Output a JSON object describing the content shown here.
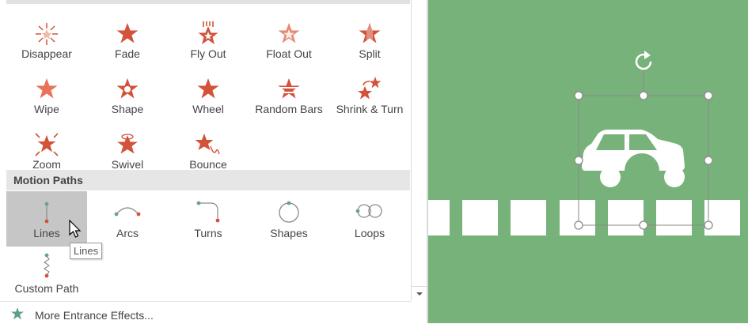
{
  "entrance_effects": [
    {
      "label": "Disappear",
      "icon": "disappear-star-icon"
    },
    {
      "label": "Fade",
      "icon": "fade-star-icon"
    },
    {
      "label": "Fly Out",
      "icon": "fly-out-star-icon"
    },
    {
      "label": "Float Out",
      "icon": "float-out-star-icon"
    },
    {
      "label": "Split",
      "icon": "split-star-icon"
    },
    {
      "label": "Wipe",
      "icon": "wipe-star-icon"
    },
    {
      "label": "Shape",
      "icon": "shape-star-icon"
    },
    {
      "label": "Wheel",
      "icon": "wheel-star-icon"
    },
    {
      "label": "Random Bars",
      "icon": "random-bars-star-icon"
    },
    {
      "label": "Shrink & Turn",
      "icon": "shrink-turn-star-icon"
    },
    {
      "label": "Zoom",
      "icon": "zoom-star-icon"
    },
    {
      "label": "Swivel",
      "icon": "swivel-star-icon"
    },
    {
      "label": "Bounce",
      "icon": "bounce-star-icon"
    }
  ],
  "motion_paths": {
    "header": "Motion Paths",
    "items": [
      {
        "label": "Lines",
        "icon": "lines-path-icon",
        "selected": true
      },
      {
        "label": "Arcs",
        "icon": "arcs-path-icon"
      },
      {
        "label": "Turns",
        "icon": "turns-path-icon"
      },
      {
        "label": "Shapes",
        "icon": "shapes-path-icon"
      },
      {
        "label": "Loops",
        "icon": "loops-path-icon"
      },
      {
        "label": "Custom Path",
        "icon": "custom-path-icon"
      }
    ]
  },
  "tooltip": "Lines",
  "footer": {
    "label": "More Entrance Effects..."
  },
  "colors": {
    "accent": "#d2533a",
    "slide_bg": "#77b27a",
    "path_green": "#6aa38a"
  }
}
